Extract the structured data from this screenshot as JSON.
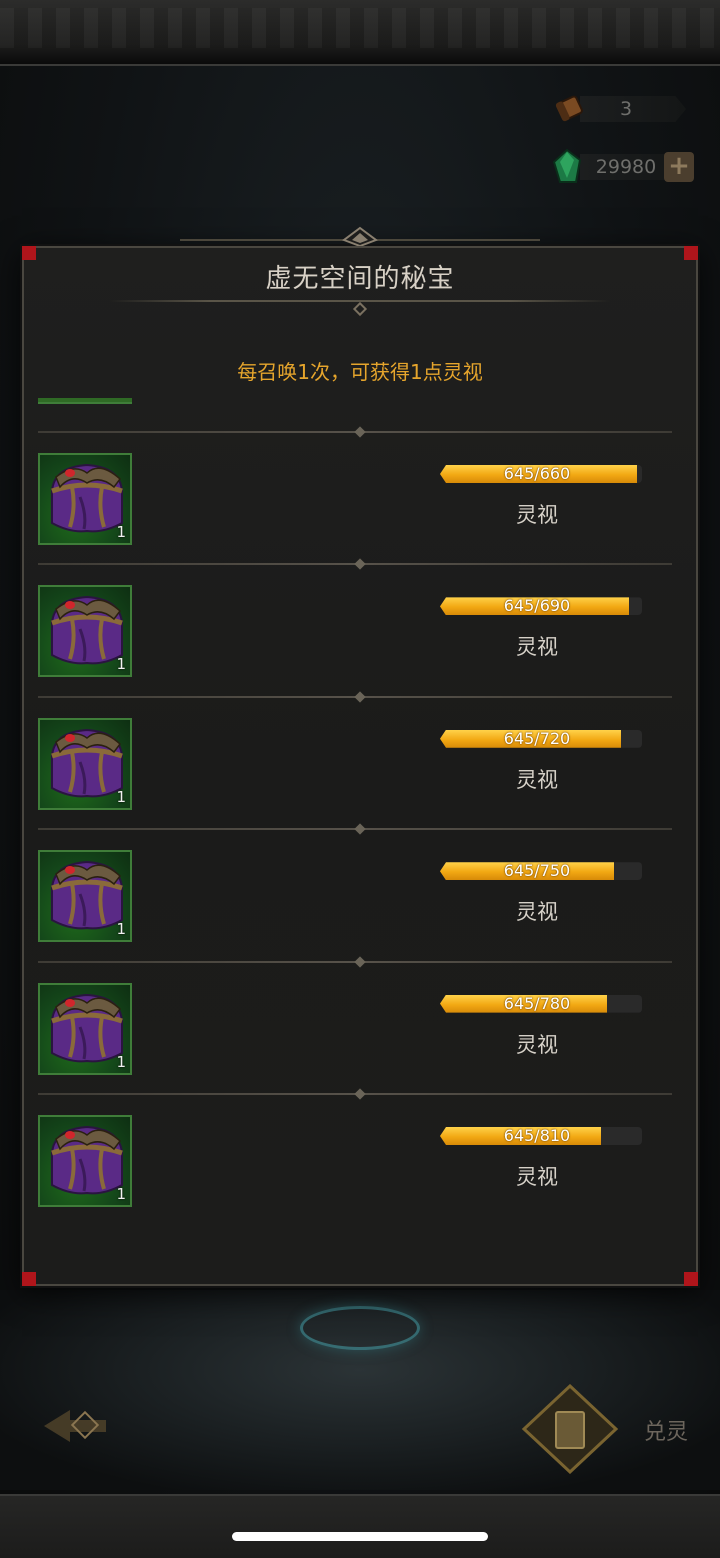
{
  "hud": {
    "scroll_count": "3",
    "gem_count": "29980",
    "plus_label": "+"
  },
  "modal": {
    "title": "虚无空间的秘宝",
    "subtitle": "每召唤1次，可获得1点灵视"
  },
  "rewards": [
    {
      "count": "1",
      "progress_text": "645/660",
      "current": 645,
      "max": 660,
      "label": "灵视"
    },
    {
      "count": "1",
      "progress_text": "645/690",
      "current": 645,
      "max": 690,
      "label": "灵视"
    },
    {
      "count": "1",
      "progress_text": "645/720",
      "current": 645,
      "max": 720,
      "label": "灵视"
    },
    {
      "count": "1",
      "progress_text": "645/750",
      "current": 645,
      "max": 750,
      "label": "灵视"
    },
    {
      "count": "1",
      "progress_text": "645/780",
      "current": 645,
      "max": 780,
      "label": "灵视"
    },
    {
      "count": "1",
      "progress_text": "645/810",
      "current": 645,
      "max": 810,
      "label": "灵视"
    }
  ],
  "bottom": {
    "exchange_label": "兑灵"
  },
  "colors": {
    "accent_gold": "#e6a52c",
    "bar_fill": "#f2a813",
    "slot_green": "#1f6b1b",
    "corner_red": "#b0151b"
  }
}
